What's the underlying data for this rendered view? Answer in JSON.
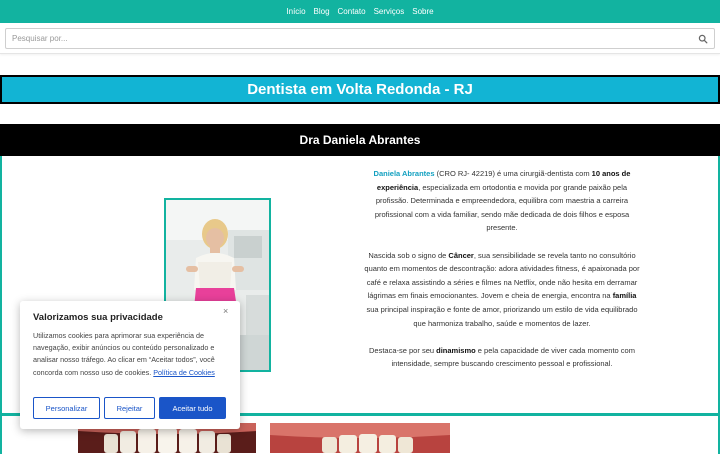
{
  "nav": {
    "items": [
      "Início",
      "Blog",
      "Contato",
      "Serviços",
      "Sobre"
    ]
  },
  "search": {
    "placeholder": "Pesquisar por..."
  },
  "page": {
    "title": "Dentista em Volta Redonda - RJ",
    "subtitle": "Dra Daniela Abrantes"
  },
  "bio": {
    "p1": {
      "name": "Daniela Abrantes",
      "t1": " (CRO RJ- 42219) é uma cirurgiã-dentista com ",
      "b1": "10 anos de experiência",
      "t2": ", especializada em ortodontia e movida por grande paixão pela profissão. Determinada e empreendedora, equilibra com maestria a carreira profissional com a vida familiar, sendo mãe dedicada de dois filhos e esposa presente."
    },
    "p2": {
      "t1": "Nascida sob o signo de ",
      "b1": "Câncer",
      "t2": ", sua sensibilidade se revela tanto no consultório quanto em momentos de descontração: adora atividades fitness, é apaixonada por café e relaxa assistindo a séries e filmes na Netflix, onde não hesita em derramar lágrimas em finais emocionantes. Jovem e cheia de energia, encontra na ",
      "b2": "família",
      "t3": " sua principal inspiração e fonte de amor, priorizando um estilo de vida equilibrado que harmoniza trabalho, saúde e momentos de lazer."
    },
    "p3": {
      "t1": "Destaca-se por seu ",
      "b1": "dinamismo",
      "t2": " e pela capacidade de viver cada momento com intensidade, sempre buscando crescimento pessoal e profissional."
    }
  },
  "cookie": {
    "title": "Valorizamos sua privacidade",
    "close": "×",
    "text": "Utilizamos cookies para aprimorar sua experiência de navegação, exibir anúncios ou conteúdo personalizado e analisar nosso tráfego. Ao clicar em “Aceitar todos”, você concorda com nosso uso de cookies. ",
    "policy_link": "Política de Cookies",
    "customize": "Personalizar",
    "reject": "Rejeitar",
    "accept": "Aceitar tudo"
  },
  "colors": {
    "nav_bg": "#12b3a0",
    "title_bg": "#12b4d4",
    "accent_blue": "#1a55c8",
    "dark_banner": "#000000"
  },
  "icons": {
    "search": "search-icon",
    "close": "close-icon"
  }
}
